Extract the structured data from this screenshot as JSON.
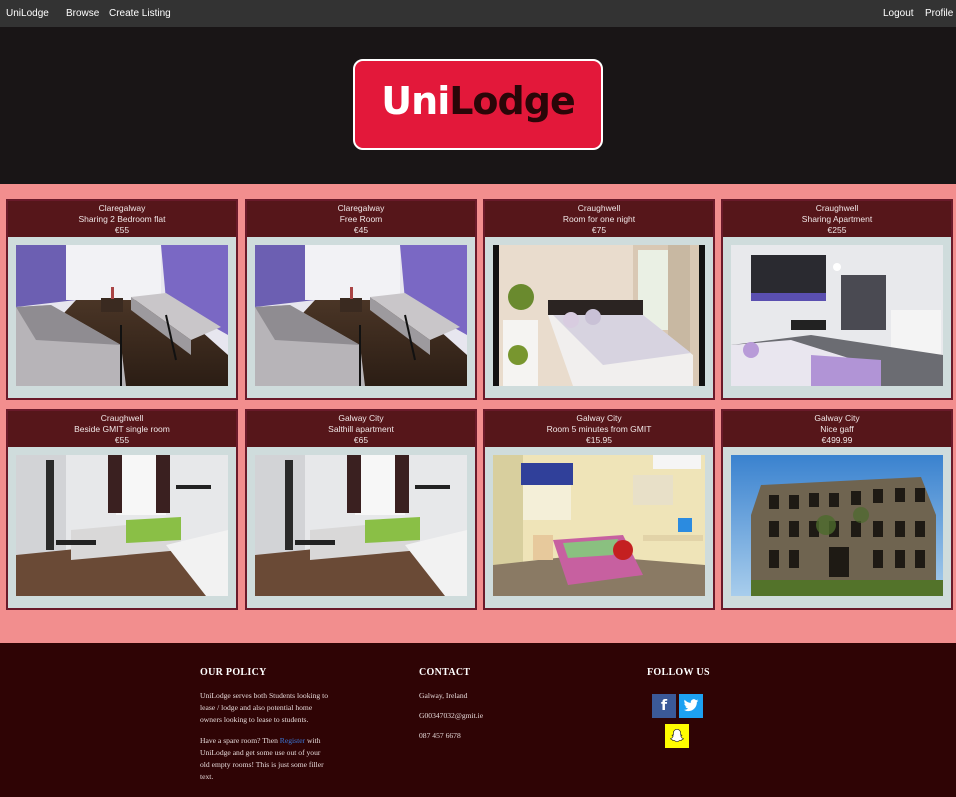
{
  "nav": {
    "brand": "UniLodge",
    "browse": "Browse",
    "create_listing": "Create Listing",
    "logout": "Logout",
    "profile": "Profile"
  },
  "logo": {
    "part1": "Uni",
    "part2": "Lodge"
  },
  "listings": [
    {
      "location": "Claregalway",
      "title": "Sharing 2 Bedroom flat",
      "price": "€55"
    },
    {
      "location": "Claregalway",
      "title": "Free Room",
      "price": "€45"
    },
    {
      "location": "Craughwell",
      "title": "Room for one night",
      "price": "€75"
    },
    {
      "location": "Craughwell",
      "title": "Sharing Apartment",
      "price": "€255"
    },
    {
      "location": "Craughwell",
      "title": "Beside GMIT single room",
      "price": "€55"
    },
    {
      "location": "Galway City",
      "title": "Salthill apartment",
      "price": "€65"
    },
    {
      "location": "Galway City",
      "title": "Room 5 minutes from GMIT",
      "price": "€15.95"
    },
    {
      "location": "Galway City",
      "title": "Nice gaff",
      "price": "€499.99"
    }
  ],
  "footer": {
    "policy_title": "OUR POLICY",
    "policy_p1": "UniLodge serves both Students looking to lease / lodge and also potential home owners looking to lease to students.",
    "policy_p2_before": "Have a spare room? Then ",
    "policy_link": "Register",
    "policy_p2_after": " with UniLodge and get some use out of your old empty rooms! This is just some filler text.",
    "contact_title": "CONTACT",
    "contact_location": "Galway, Ireland",
    "contact_email": "G00347032@gmit.ie",
    "contact_phone": "087 457 6678",
    "follow_title": "FOLLOW US",
    "social": {
      "facebook": "f",
      "twitter": "t"
    }
  },
  "colors": {
    "navbar": "#333333",
    "header": "#191516",
    "logo_red": "#e3183a",
    "page_bg": "#f28e8e",
    "card_head": "#56161a",
    "footer": "#2f0405",
    "facebook": "#3b5998",
    "twitter": "#1da1f2",
    "snapchat": "#fffc00"
  }
}
